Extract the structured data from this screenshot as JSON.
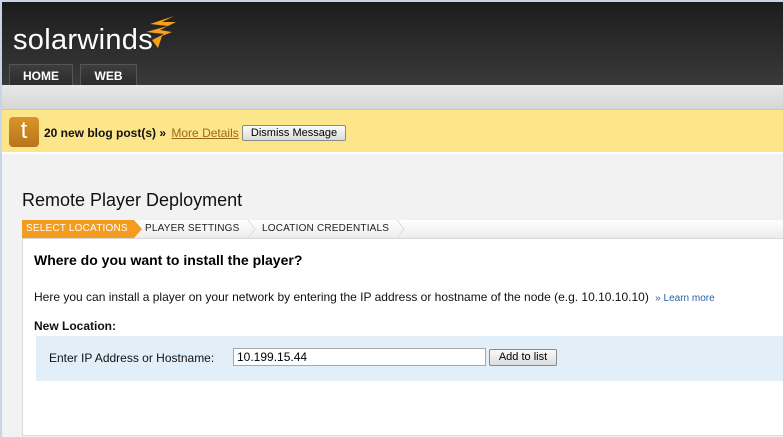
{
  "header": {
    "logo": "solarwinds",
    "tabs": [
      {
        "label": "HOME"
      },
      {
        "label": "WEB"
      }
    ]
  },
  "banner": {
    "message": "20 new blog post(s)",
    "separator": "»",
    "more_link": "More Details",
    "dismiss": "Dismiss Message",
    "icon_letter": "t"
  },
  "page": {
    "title": "Remote Player Deployment"
  },
  "wizard": {
    "steps": [
      {
        "label": "SELECT LOCATIONS",
        "active": true
      },
      {
        "label": "PLAYER SETTINGS"
      },
      {
        "label": "LOCATION CREDENTIALS"
      }
    ]
  },
  "panel": {
    "heading": "Where do you want to install the player?",
    "description": "Here you can install a player on your network by entering the IP address or hostname of the node (e.g. 10.10.10.10)",
    "learn_more": "» Learn more",
    "new_location": "New Location:",
    "field_label": "Enter IP Address or Hostname:",
    "field_value": "10.199.15.44",
    "add_button": "Add to list"
  },
  "colors": {
    "accent": "#f39c1f",
    "banner": "#fde58a",
    "box": "#e2eff8"
  }
}
